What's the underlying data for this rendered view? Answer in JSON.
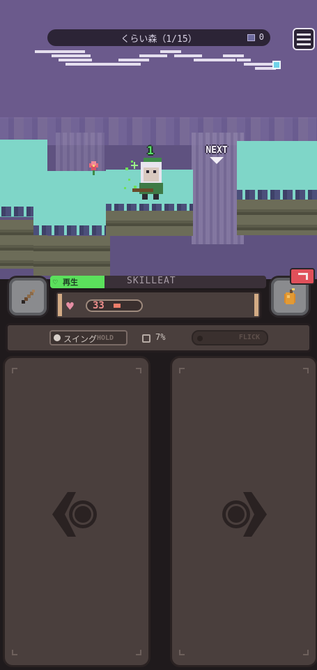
{
  "stage": {
    "title": "くらい森（1/15）",
    "gem_count": "0"
  },
  "scene": {
    "next_label": "NEXT",
    "combo": "1"
  },
  "skill": {
    "status_label": "再生",
    "name": "SKILLEAT",
    "fill_fraction": 0.25
  },
  "player": {
    "hp": "33",
    "hp_fraction": 0.1
  },
  "actions": {
    "swing_label": "スイング",
    "swing_hint": "HOLD",
    "percent": "7%",
    "flick_label": "FLICK"
  },
  "icons": {
    "weapon": "sword-icon",
    "item": "bomb-icon",
    "menu": "hamburger-menu-icon",
    "left": "left-arrow-icon",
    "right": "right-arrow-icon"
  },
  "colors": {
    "skill_green": "#5be05c",
    "hp_pink": "#e68fa5",
    "badge_red": "#e0505a",
    "sky_purple": "#6b5a8c",
    "ground_teal": "#7fd6c8"
  }
}
